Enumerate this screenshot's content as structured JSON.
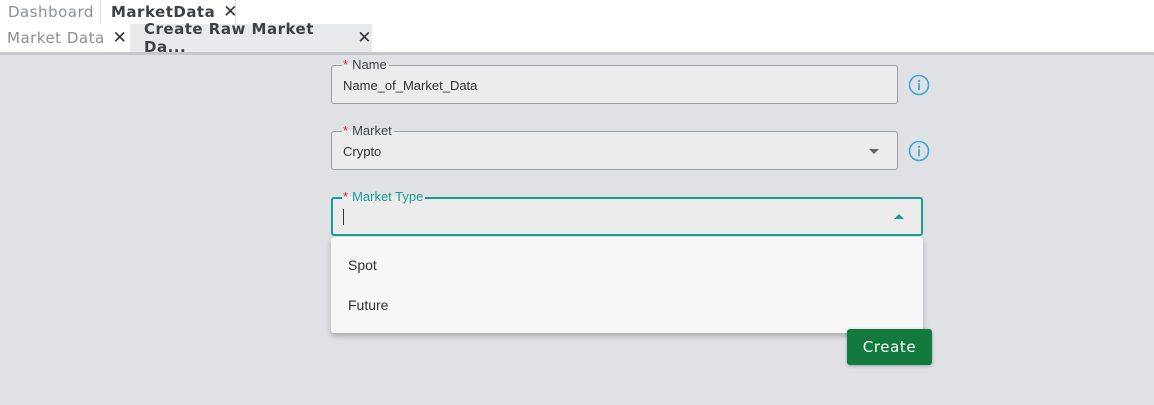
{
  "tabs_primary": {
    "dashboard_label": "Dashboard",
    "marketdata_label": "MarketData",
    "close_glyph": "✕"
  },
  "tabs_secondary": {
    "market_data_label": "Market Data",
    "create_raw_label": "Create Raw Market Da...",
    "close_glyph": "✕"
  },
  "form": {
    "name": {
      "label": "Name",
      "required_mark": "*",
      "value": "Name_of_Market_Data"
    },
    "market": {
      "label": "Market",
      "required_mark": "*",
      "value": "Crypto"
    },
    "market_type": {
      "label": "Market Type",
      "required_mark": "*",
      "value": ""
    }
  },
  "dropdown": {
    "options": [
      "Spot",
      "Future"
    ]
  },
  "actions": {
    "create_label": "Create"
  },
  "colors": {
    "accent": "#1a9c96",
    "required": "#d62b2b",
    "primary_button": "#137a3d",
    "info_icon": "#3aa8d8"
  },
  "icons": {
    "info": "info-icon",
    "dropdown_closed": "chevron-down-icon",
    "dropdown_open": "chevron-up-icon",
    "close": "close-icon"
  }
}
